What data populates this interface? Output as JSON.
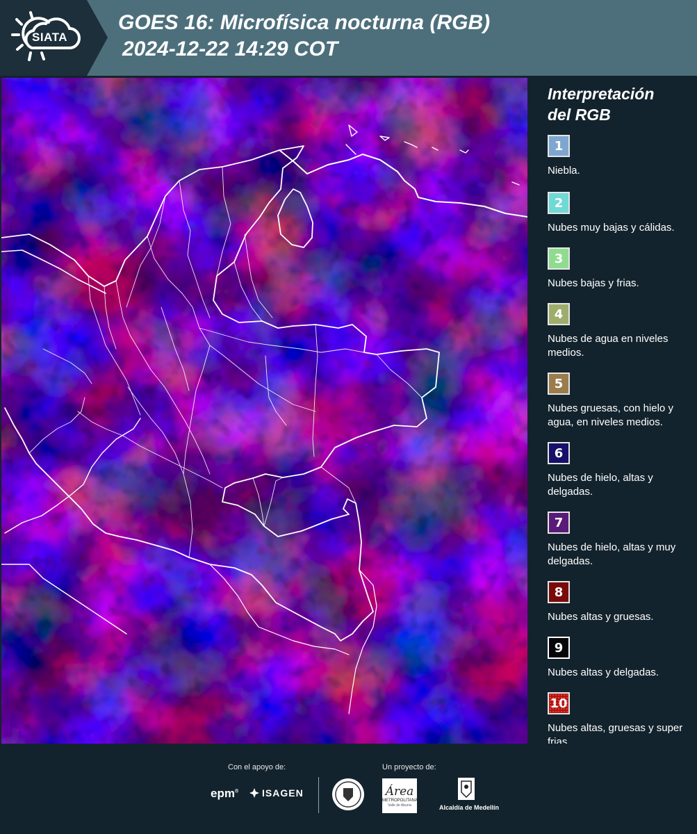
{
  "header": {
    "logo_text": "SIATA",
    "title_line1": "GOES 16: Microfísica nocturna (RGB)",
    "title_line2": "2024-12-22 14:29 COT",
    "background_color": "#4d6f7c"
  },
  "legend": {
    "title_line1": "Interpretación",
    "title_line2": "del RGB",
    "items": [
      {
        "number": "1",
        "label": "Niebla.",
        "color": "#7ea7cf"
      },
      {
        "number": "2",
        "label": "Nubes muy bajas y cálidas.",
        "color": "#6fd9d5"
      },
      {
        "number": "3",
        "label": "Nubes bajas y frias.",
        "color": "#8fdc8f"
      },
      {
        "number": "4",
        "label": "Nubes de agua en niveles medios.",
        "color": "#9fad6c"
      },
      {
        "number": "5",
        "label": "Nubes gruesas, con hielo y agua, en niveles medios.",
        "color": "#9b7c4d"
      },
      {
        "number": "6",
        "label": "Nubes de hielo, altas y delgadas.",
        "color": "#16106b"
      },
      {
        "number": "7",
        "label": "Nubes de hielo, altas y muy delgadas.",
        "color": "#5a1a7a"
      },
      {
        "number": "8",
        "label": "Nubes altas y gruesas.",
        "color": "#7a0b0b"
      },
      {
        "number": "9",
        "label": "Nubes altas y delgadas.",
        "color": "#05050a"
      },
      {
        "number": "10",
        "label": "Nubes altas, gruesas y super frias.",
        "color": "#b3140f"
      }
    ]
  },
  "footer": {
    "support_label": "Con el apoyo de:",
    "project_label": "Un proyecto de:",
    "sponsors": [
      "epm",
      "ISAGEN"
    ],
    "partners": {
      "area_main": "Área",
      "area_sub1": "METROPOLITANA",
      "area_sub2": "Valle de Aburrá",
      "medellin": "Alcaldía de Medellín"
    }
  },
  "map": {
    "colors": {
      "blue": "#2a1cf2",
      "red": "#8e0b1c",
      "dark": "#1a0522",
      "border": "#ffffff"
    }
  }
}
